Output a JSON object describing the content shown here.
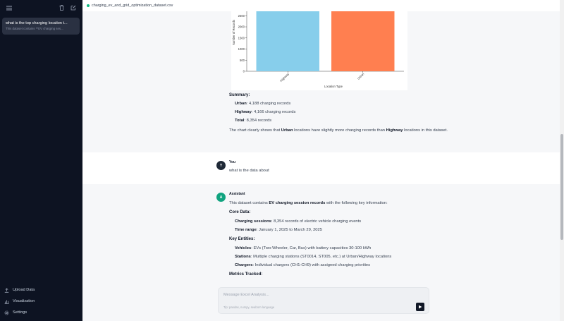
{
  "sidebar": {
    "chat": {
      "title": "what is the top charging location t...",
      "subtitle": "This dataset contains **EV charging ses..."
    },
    "links": [
      {
        "label": "Upload Data",
        "icon": "upload-icon"
      },
      {
        "label": "Visualization",
        "icon": "chart-icon"
      },
      {
        "label": "Settings",
        "icon": "gear-icon"
      }
    ]
  },
  "topbar": {
    "filename": "charging_ev_and_grid_optimization_dataset.csv"
  },
  "chart_data": {
    "type": "bar",
    "categories": [
      "Highway",
      "Urban"
    ],
    "values": [
      4166,
      4188
    ],
    "xlabel": "Location Type",
    "ylabel": "Number of Records",
    "yticks": [
      0,
      500,
      1000,
      1500,
      2000,
      2500
    ],
    "ylim": [
      0,
      2700
    ],
    "colors": [
      "#87ceeb",
      "#ff7f50"
    ]
  },
  "msg1": {
    "summary_title": "Summary:",
    "items": [
      {
        "label": "Urban",
        "text": ": 4,188 charging records"
      },
      {
        "label": "Highway",
        "text": ": 4,166 charging records"
      },
      {
        "label": "Total",
        "text": ": 8,354 records"
      }
    ],
    "conclusion": {
      "p1": "The chart clearly shows that ",
      "b1": "Urban",
      "p2": " locations have slightly more charging records than ",
      "b2": "Highway",
      "p3": " locations in this dataset."
    }
  },
  "user_msg": {
    "avatar": "Y",
    "role": "You",
    "text": "what is the data about"
  },
  "msg2": {
    "avatar": "A",
    "role": "Assistant",
    "intro_pre": "This dataset contains ",
    "intro_bold": "EV charging session records",
    "intro_post": " with the following key information:",
    "core_title": "Core Data:",
    "core_items": [
      {
        "label": "Charging sessions",
        "text": ": 8,354 records of electric vehicle charging events"
      },
      {
        "label": "Time range",
        "text": ": January 1, 2025 to March 29, 2025"
      }
    ],
    "entities_title": "Key Entities:",
    "entity_items": [
      {
        "label": "Vehicles",
        "text": ": EVs (Two-Wheeler, Car, Bus) with battery capacities 30-100 kWh"
      },
      {
        "label": "Stations",
        "text": ": Multiple charging stations (ST0014, ST005, etc.) at Urban/Highway locations"
      },
      {
        "label": "Chargers",
        "text": ": Individual chargers (CH1-CH9) with assigned charging priorities"
      }
    ],
    "metrics_title": "Metrics Tracked:"
  },
  "input": {
    "placeholder": "Message Excel Analysis...",
    "hint": "Tip: pandas, numpy, seaborn language"
  },
  "colors": {
    "sidebar_bg": "#0d1322",
    "assistant_avatar": "#10a37f",
    "user_avatar": "#1f2937"
  }
}
